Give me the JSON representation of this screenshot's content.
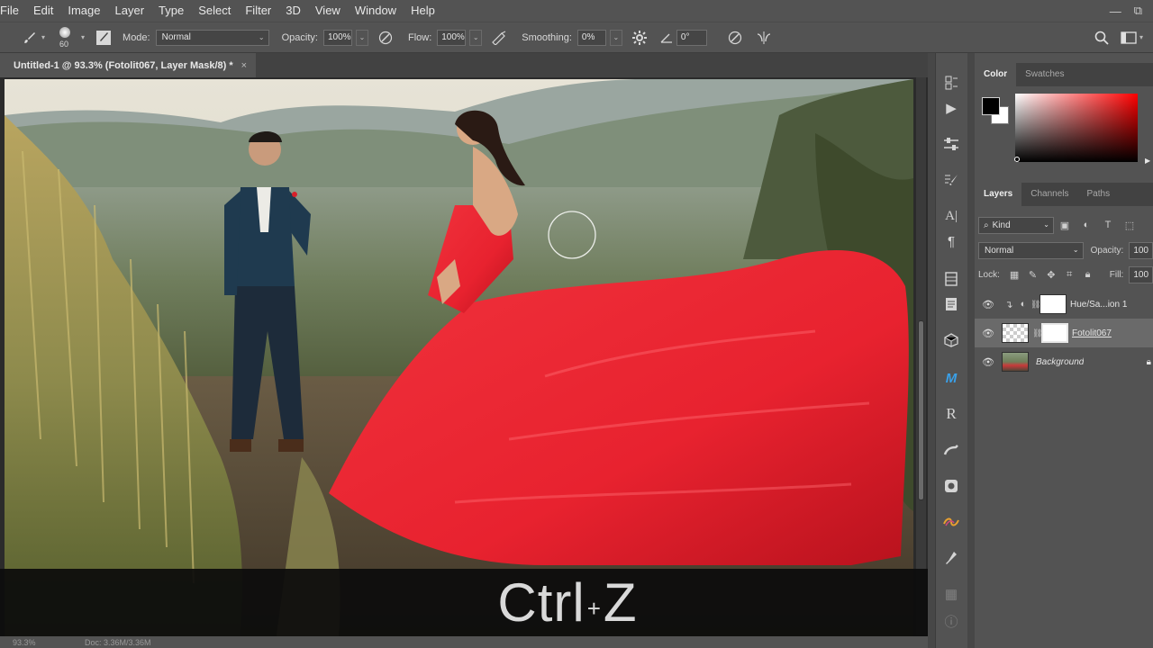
{
  "menu": [
    "File",
    "Edit",
    "Image",
    "Layer",
    "Type",
    "Select",
    "Filter",
    "3D",
    "View",
    "Window",
    "Help"
  ],
  "window_controls": {
    "minimize": "—",
    "restore": "⧉"
  },
  "options_bar": {
    "brush_size": "60",
    "mode_label": "Mode:",
    "mode_value": "Normal",
    "opacity_label": "Opacity:",
    "opacity_value": "100%",
    "flow_label": "Flow:",
    "flow_value": "100%",
    "smoothing_label": "Smoothing:",
    "smoothing_value": "0%",
    "angle_value": "0°"
  },
  "document_tab": {
    "title": "Untitled-1 @ 93.3% (Fotolit067, Layer Mask/8) *",
    "close": "×"
  },
  "panels": {
    "color_tabs": [
      "Color",
      "Swatches"
    ],
    "layer_tabs": [
      "Layers",
      "Channels",
      "Paths"
    ],
    "kind_label": "Kind",
    "blend_mode": "Normal",
    "opacity_label": "Opacity:",
    "opacity_value": "100",
    "lock_label": "Lock:",
    "fill_label": "Fill:",
    "fill_value": "100",
    "layers": [
      {
        "name": "Hue/Sa...ion 1",
        "visible": true,
        "selected": false
      },
      {
        "name": "Fotolit067",
        "visible": true,
        "selected": true
      },
      {
        "name": "Background",
        "visible": true,
        "selected": false
      }
    ]
  },
  "caption": {
    "key1": "Ctrl",
    "plus": "+",
    "key2": "Z"
  },
  "status": {
    "zoom": "93.3%",
    "doc": "Doc: 3.36M/3.36M"
  },
  "colors": {
    "foreground": "#000000",
    "background": "#ffffff",
    "dress": "#e8222f",
    "ui_panel": "#535353"
  }
}
